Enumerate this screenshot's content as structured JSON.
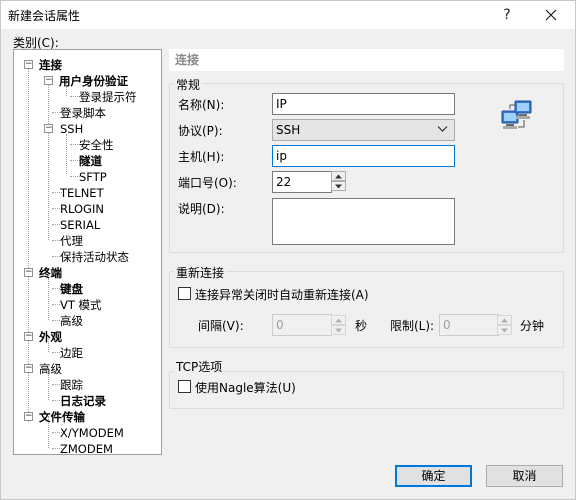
{
  "window": {
    "title": "新建会话属性",
    "help_symbol": "?",
    "close_symbol": "close"
  },
  "category_label": "类别(C):",
  "tree": [
    {
      "label": "连接",
      "bold": true,
      "toggle": "−"
    },
    {
      "label": "用户身份验证",
      "bold": true,
      "toggle": "−"
    },
    {
      "label": "登录提示符",
      "bold": false
    },
    {
      "label": "登录脚本",
      "bold": false
    },
    {
      "label": "SSH",
      "bold": false,
      "toggle": "−"
    },
    {
      "label": "安全性",
      "bold": false
    },
    {
      "label": "隧道",
      "bold": true
    },
    {
      "label": "SFTP",
      "bold": false
    },
    {
      "label": "TELNET",
      "bold": false
    },
    {
      "label": "RLOGIN",
      "bold": false
    },
    {
      "label": "SERIAL",
      "bold": false
    },
    {
      "label": "代理",
      "bold": false
    },
    {
      "label": "保持活动状态",
      "bold": false
    },
    {
      "label": "终端",
      "bold": true,
      "toggle": "−"
    },
    {
      "label": "键盘",
      "bold": true
    },
    {
      "label": "VT 模式",
      "bold": false
    },
    {
      "label": "高级",
      "bold": false
    },
    {
      "label": "外观",
      "bold": true,
      "toggle": "−"
    },
    {
      "label": "边距",
      "bold": false
    },
    {
      "label": "高级",
      "bold": false,
      "toggle": "−"
    },
    {
      "label": "跟踪",
      "bold": false
    },
    {
      "label": "日志记录",
      "bold": true
    },
    {
      "label": "文件传输",
      "bold": true,
      "toggle": "−"
    },
    {
      "label": "X/YMODEM",
      "bold": false
    },
    {
      "label": "ZMODEM",
      "bold": false
    }
  ],
  "panel": {
    "header": "连接",
    "general": {
      "title": "常规",
      "name_label": "名称(N):",
      "name_value": "IP",
      "protocol_label": "协议(P):",
      "protocol_value": "SSH",
      "host_label": "主机(H):",
      "host_value": "ip",
      "port_label": "端口号(O):",
      "port_value": "22",
      "desc_label": "说明(D):",
      "desc_value": ""
    },
    "reconnect": {
      "title": "重新连接",
      "checkbox_label": "连接异常关闭时自动重新连接(A)",
      "checked": false,
      "interval_label": "间隔(V):",
      "interval_value": "0",
      "interval_unit": "秒",
      "limit_label": "限制(L):",
      "limit_value": "0",
      "limit_unit": "分钟"
    },
    "tcp": {
      "title": "TCP选项",
      "nagle_label": "使用Nagle算法(U)",
      "checked": false
    }
  },
  "buttons": {
    "ok": "确定",
    "cancel": "取消"
  },
  "icons": {
    "panel_icon": "network-computers-icon"
  },
  "colors": {
    "accent": "#0078d7",
    "dialog_bg": "#f0f0f0"
  }
}
